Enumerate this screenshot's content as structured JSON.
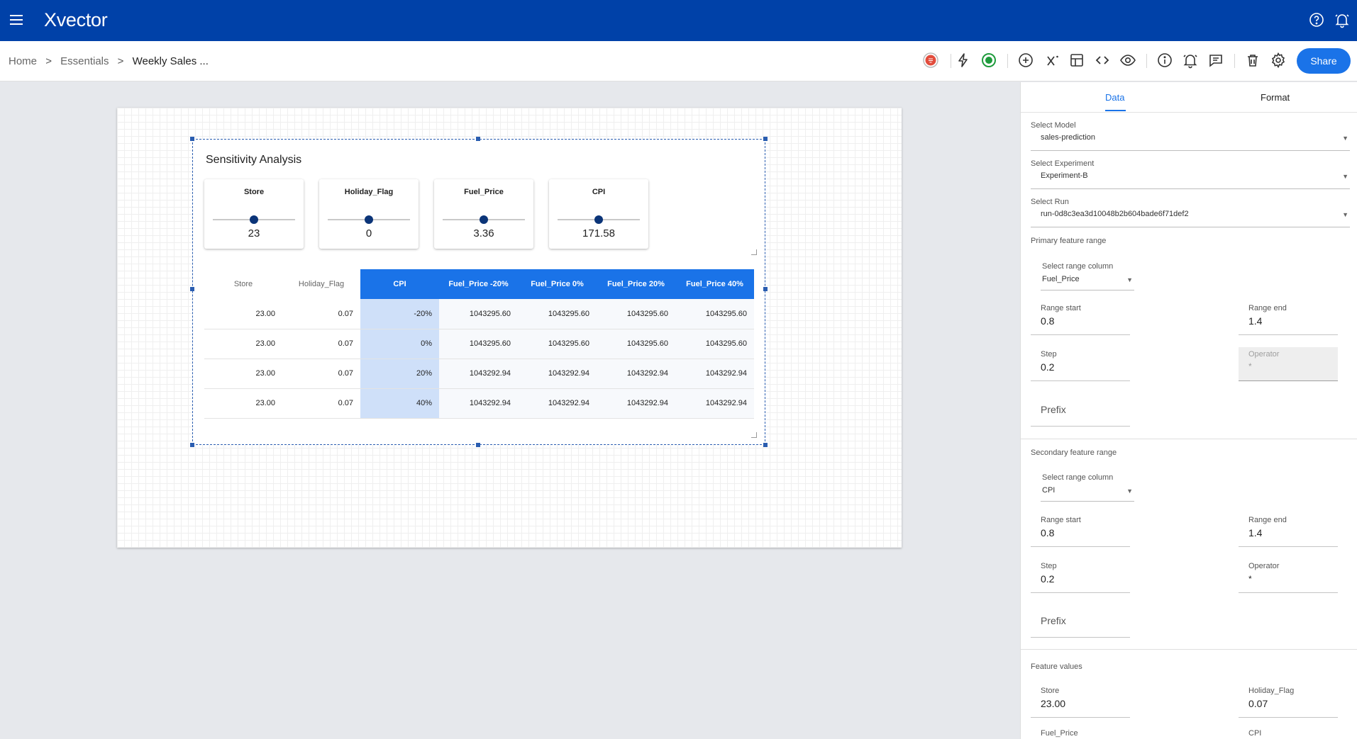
{
  "app": {
    "name": "Xvector"
  },
  "breadcrumb": {
    "home": "Home",
    "sep1": ">",
    "essentials": "Essentials",
    "sep2": ">",
    "current": "Weekly Sales ..."
  },
  "toolbar": {
    "share_label": "Share"
  },
  "colors": {
    "brand": "#0041a8",
    "accent": "#1a73e8",
    "slider_thumb": "#0b3478",
    "status_green": "#1e9b3c",
    "status_red": "#e24c3c"
  },
  "widget": {
    "title": "Sensitivity Analysis",
    "sliders": [
      {
        "label": "Store",
        "value": "23",
        "position": 0.5
      },
      {
        "label": "Holiday_Flag",
        "value": "0",
        "position": 0.5
      },
      {
        "label": "Fuel_Price",
        "value": "3.36",
        "position": 0.5
      },
      {
        "label": "CPI",
        "value": "171.58",
        "position": 0.5
      }
    ],
    "table": {
      "headers": [
        "Store",
        "Holiday_Flag",
        "CPI",
        "Fuel_Price -20%",
        "Fuel_Price 0%",
        "Fuel_Price 20%",
        "Fuel_Price 40%"
      ],
      "rows": [
        [
          "23.00",
          "0.07",
          "-20%",
          "1043295.60",
          "1043295.60",
          "1043295.60",
          "1043295.60"
        ],
        [
          "23.00",
          "0.07",
          "0%",
          "1043295.60",
          "1043295.60",
          "1043295.60",
          "1043295.60"
        ],
        [
          "23.00",
          "0.07",
          "20%",
          "1043292.94",
          "1043292.94",
          "1043292.94",
          "1043292.94"
        ],
        [
          "23.00",
          "0.07",
          "40%",
          "1043292.94",
          "1043292.94",
          "1043292.94",
          "1043292.94"
        ]
      ]
    }
  },
  "panel": {
    "tabs": {
      "data": "Data",
      "format": "Format"
    },
    "select_model": {
      "label": "Select Model",
      "value": "sales-prediction"
    },
    "select_experiment": {
      "label": "Select Experiment",
      "value": "Experiment-B"
    },
    "select_run": {
      "label": "Select Run",
      "value": "run-0d8c3ea3d10048b2b604bade6f71def2"
    },
    "primary": {
      "title": "Primary feature range",
      "range_column": {
        "label": "Select range column",
        "value": "Fuel_Price"
      },
      "range_start": {
        "label": "Range start",
        "value": "0.8"
      },
      "range_end": {
        "label": "Range end",
        "value": "1.4"
      },
      "step": {
        "label": "Step",
        "value": "0.2"
      },
      "operator": {
        "label": "Operator",
        "value": "*"
      },
      "prefix": {
        "placeholder": "Prefix"
      }
    },
    "secondary": {
      "title": "Secondary feature range",
      "range_column": {
        "label": "Select range column",
        "value": "CPI"
      },
      "range_start": {
        "label": "Range start",
        "value": "0.8"
      },
      "range_end": {
        "label": "Range end",
        "value": "1.4"
      },
      "step": {
        "label": "Step",
        "value": "0.2"
      },
      "operator": {
        "label": "Operator",
        "value": "*"
      },
      "prefix": {
        "placeholder": "Prefix"
      }
    },
    "feature_values": {
      "title": "Feature values",
      "store": {
        "label": "Store",
        "value": "23.00"
      },
      "holiday_flag": {
        "label": "Holiday_Flag",
        "value": "0.07"
      },
      "fuel_price": {
        "label": "Fuel_Price"
      },
      "cpi": {
        "label": "CPI"
      }
    }
  },
  "icons": {
    "menu": "hamburger-menu-icon",
    "help": "help-circle-icon",
    "notifications": "bell-icon",
    "status_red": "status-record-icon",
    "lightning": "lightning-icon",
    "status_green": "status-active-icon",
    "add": "add-circle-icon",
    "formula": "formula-x-icon",
    "layout": "layout-icon",
    "code": "code-icon",
    "preview": "eye-icon",
    "info": "info-icon",
    "alerts": "alarm-icon",
    "comments": "comment-icon",
    "delete": "trash-icon",
    "settings": "gear-icon"
  }
}
